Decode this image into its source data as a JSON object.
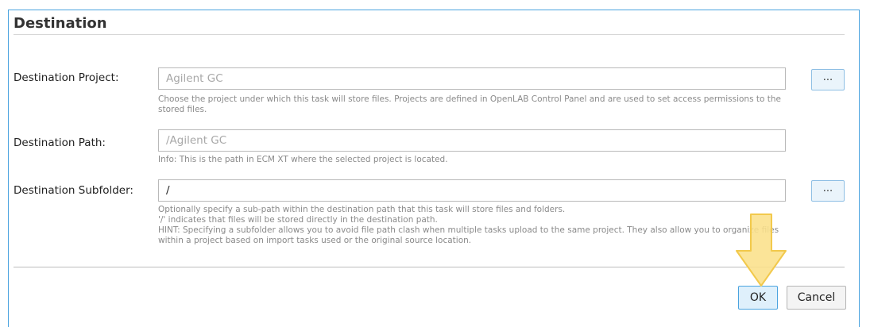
{
  "section": {
    "title": "Destination"
  },
  "project": {
    "label": "Destination Project:",
    "placeholder": "Agilent GC",
    "browse_label": "...",
    "help": "Choose the project under which this task will store files. Projects are defined in OpenLAB Control Panel and are used to set access permissions to the stored files."
  },
  "path": {
    "label": "Destination Path:",
    "placeholder": "/Agilent GC",
    "help": "Info: This is the path in ECM XT where the selected project is located."
  },
  "subfolder": {
    "label": "Destination Subfolder:",
    "value": "/",
    "browse_label": "...",
    "help_line1": "Optionally specify a sub-path within the destination path that this task will store files and folders.",
    "help_line2": "'/' indicates that files will be stored directly in the destination path.",
    "help_line3": "HINT: Specifying a subfolder allows you to avoid file path clash when multiple tasks upload to the same project. They also allow you to organize files within a project based on import tasks used or the original source location."
  },
  "footer": {
    "ok_label": "OK",
    "cancel_label": "Cancel"
  },
  "colors": {
    "frame_border": "#4aa3df",
    "ok_button": "#dff0fb",
    "highlight_arrow": "#fbe08a"
  },
  "icons": {
    "highlight_arrow": "down-arrow-icon"
  }
}
